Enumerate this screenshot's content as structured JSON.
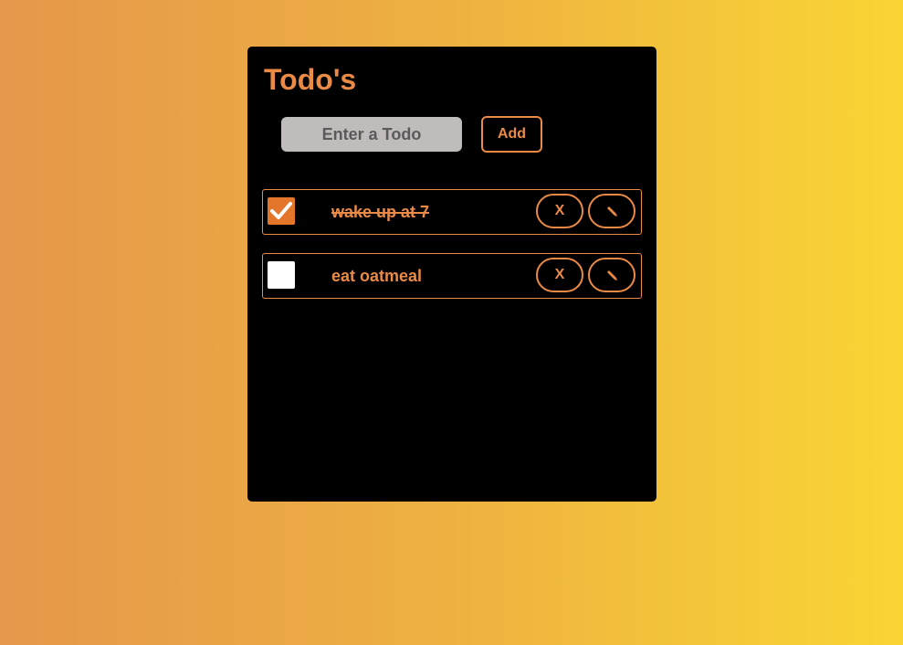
{
  "app": {
    "title": "Todo's"
  },
  "form": {
    "input_placeholder": "Enter a Todo",
    "input_value": "",
    "add_label": "Add"
  },
  "todos": [
    {
      "text": "wake up at 7",
      "completed": true,
      "delete_label": "X",
      "edit_icon": "pencil-icon"
    },
    {
      "text": "eat oatmeal",
      "completed": false,
      "delete_label": "X",
      "edit_icon": "pencil-icon"
    }
  ],
  "colors": {
    "accent": "#ea8a45",
    "checkbox_checked": "#e4762c",
    "card_background": "#000000",
    "input_background": "#c0bcbc",
    "gradient_start": "#e5974b",
    "gradient_end": "#f9d534"
  }
}
